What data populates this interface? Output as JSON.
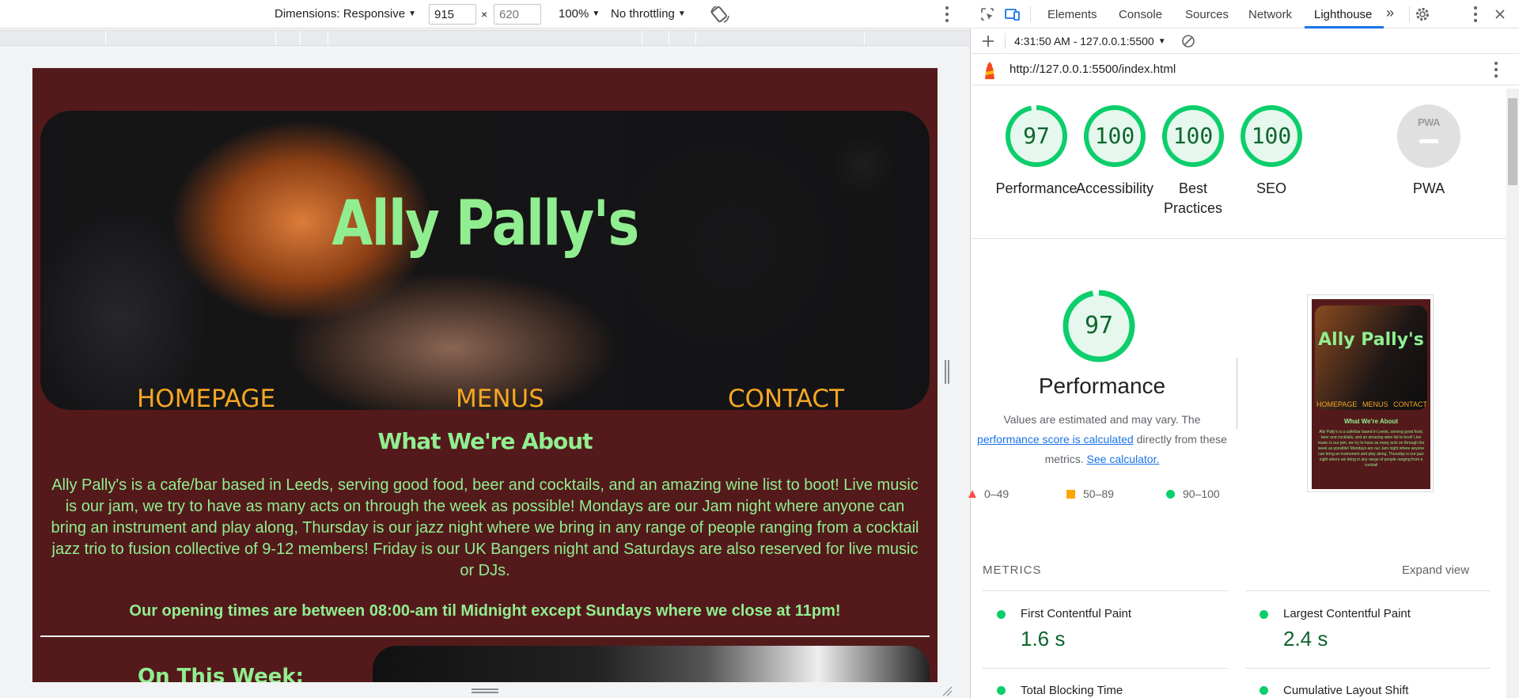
{
  "device_toolbar": {
    "dimensions_label": "Dimensions: Responsive",
    "width_value": "915",
    "height_placeholder": "620",
    "times": "×",
    "zoom": "100%",
    "throttling": "No throttling"
  },
  "site": {
    "title": "Ally Pally's",
    "nav": [
      "HOMEPAGE",
      "MENUS",
      "CONTACT"
    ],
    "section_title": "What We're About",
    "about": "Ally Pally's is a cafe/bar based in Leeds, serving good food, beer and cocktails, and an amazing wine list to boot! Live music is our jam, we try to have as many acts on through the week as possible! Mondays are our Jam night where anyone can bring an instrument and play along, Thursday is our jazz night where we bring in any range of people ranging from a cocktail jazz trio to fusion collective of 9-12 members! Friday is our UK Bangers night and Saturdays are also reserved for live music or DJs.",
    "hours": "Our opening times are between 08:00-am til Midnight except Sundays where we close at 11pm!",
    "on_this_week": "On This Week:",
    "colors": {
      "background": "#541a1b",
      "accent_green": "#90ee90",
      "nav_orange": "#f5a623"
    }
  },
  "devtools": {
    "tabs": [
      "Elements",
      "Console",
      "Sources",
      "Network",
      "Lighthouse"
    ],
    "active_tab": "Lighthouse",
    "report_select": "4:31:50 AM - 127.0.0.1:5500",
    "url": "http://127.0.0.1:5500/index.html"
  },
  "lighthouse": {
    "scores": [
      {
        "label": "Performance",
        "value": "97",
        "fraction": 0.97
      },
      {
        "label": "Accessibility",
        "value": "100",
        "fraction": 1.0
      },
      {
        "label": "Best Practices",
        "value": "100",
        "fraction": 1.0
      },
      {
        "label": "SEO",
        "value": "100",
        "fraction": 1.0
      }
    ],
    "pwa_label": "PWA",
    "pwa_badge": "PWA",
    "detail": {
      "score": "97",
      "fraction": 0.97,
      "title": "Performance",
      "desc_1": "Values are estimated and may vary. The",
      "link_1": "performance score is calculated",
      "desc_2": " directly from these",
      "desc_3": "metrics. ",
      "link_2": "See calculator."
    },
    "legend": [
      "0–49",
      "50–89",
      "90–100"
    ],
    "legend_colors": [
      "#ff4e42",
      "#ffa400",
      "#0cce6b"
    ],
    "thumbnail": {
      "title": "Ally Pally's",
      "nav": [
        "HOMEPAGE",
        "MENUS",
        "CONTACT"
      ],
      "sub": "What We're About",
      "body": "Ally Pally's is a cafe/bar based in Leeds, serving good food, beer and cocktails, and an amazing wine list to boot! Live music is our jam, we try to have as many acts on through the week as possible! Mondays are our Jam night where anyone can bring an instrument and play along, Thursday is our jazz night where we bring in any range of people ranging from a cocktail"
    },
    "metrics_heading": "METRICS",
    "expand_view": "Expand view",
    "metrics": [
      {
        "name": "First Contentful Paint",
        "value": "1.6 s"
      },
      {
        "name": "Largest Contentful Paint",
        "value": "2.4 s"
      },
      {
        "name": "Total Blocking Time",
        "value": ""
      },
      {
        "name": "Cumulative Layout Shift",
        "value": ""
      }
    ],
    "pass_color": "#0cce6b"
  }
}
